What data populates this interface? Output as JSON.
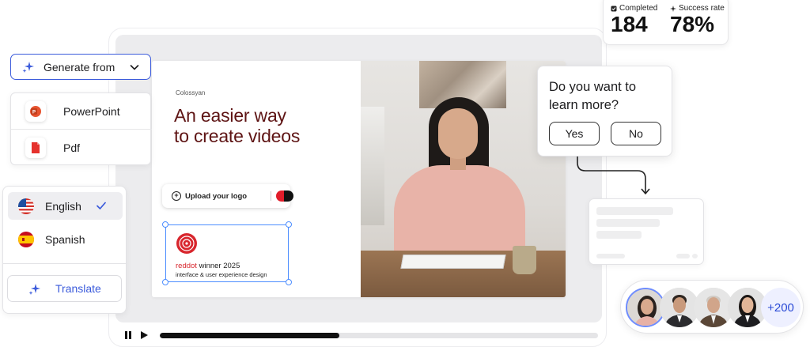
{
  "generate": {
    "label": "Generate from",
    "icon": "sparkle-icon",
    "chevron": "chevron-down-icon"
  },
  "import_menu": [
    {
      "label": "PowerPoint",
      "icon": "powerpoint-icon"
    },
    {
      "label": "Pdf",
      "icon": "pdf-icon"
    }
  ],
  "languages": {
    "items": [
      {
        "label": "English",
        "flag": "us-flag-icon",
        "selected": true
      },
      {
        "label": "Spanish",
        "flag": "spain-flag-icon",
        "selected": false
      }
    ],
    "translate_label": "Translate"
  },
  "slide": {
    "brand": "Colossyan",
    "headline_line1": "An easier way",
    "headline_line2": "to create videos",
    "upload_label": "Upload your logo",
    "award_red": "red",
    "award_dot": "dot",
    "award_rest": " winner 2025",
    "award_sub": "interface & user experience design"
  },
  "stats": {
    "completed_label": "Completed",
    "completed_value": "184",
    "success_label": "Success rate",
    "success_value": "78%"
  },
  "quiz": {
    "question": "Do you want to learn more?",
    "yes": "Yes",
    "no": "No"
  },
  "avatars": {
    "more_label": "+200",
    "count_shown": 4
  },
  "player": {
    "progress": 0.41
  },
  "colors": {
    "accent": "#3b5bdb",
    "headline": "#5e1414",
    "award_red": "#d8262d"
  }
}
